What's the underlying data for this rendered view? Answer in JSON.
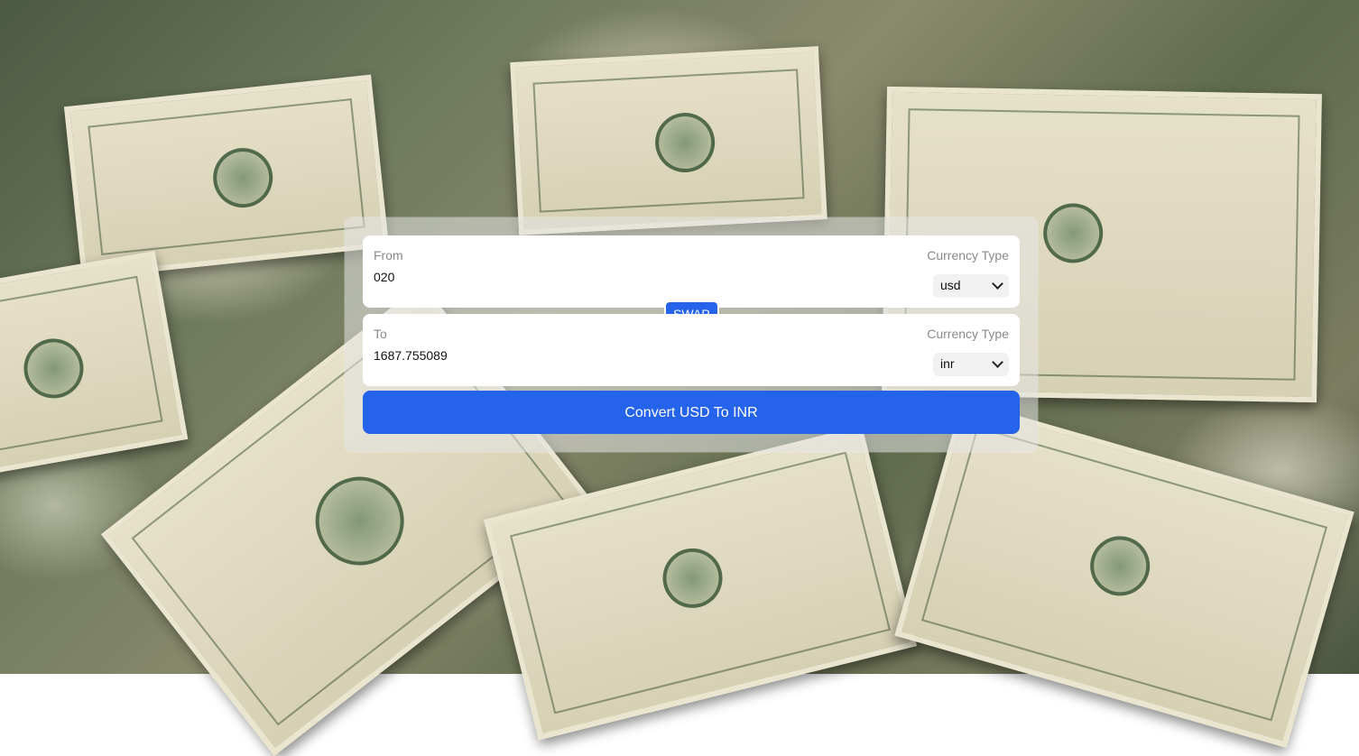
{
  "background": {
    "description_icon": "money-background-icon"
  },
  "from": {
    "label": "From",
    "amount": "020",
    "currency_label": "Currency Type",
    "currency": "usd"
  },
  "to": {
    "label": "To",
    "amount": "1687.755089",
    "currency_label": "Currency Type",
    "currency": "inr"
  },
  "swap_label": "SWAP",
  "convert_label": "Convert USD To INR",
  "colors": {
    "accent": "#2563eb",
    "card": "#ffffff"
  }
}
